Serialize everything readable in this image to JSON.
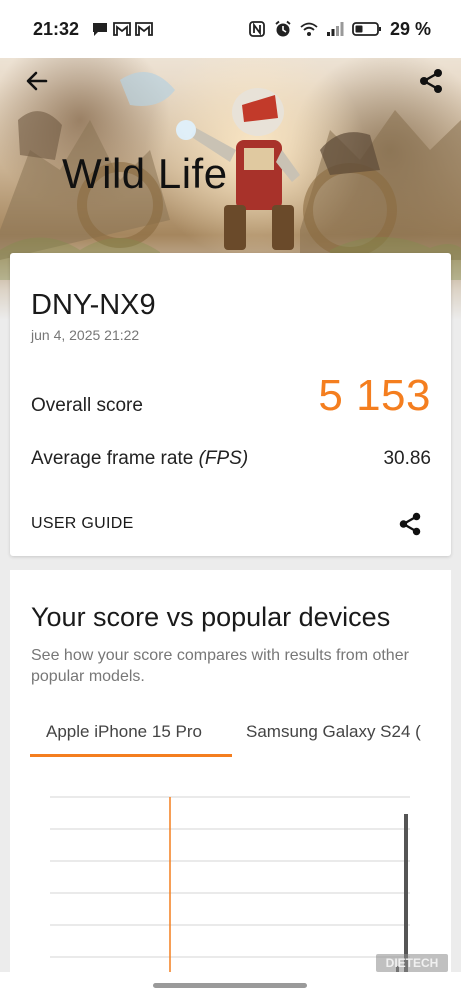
{
  "status_bar": {
    "time": "21:32",
    "battery_percent": "29 %",
    "left_icons": [
      "chat-bubble-icon",
      "gmail-icon",
      "gmail-icon"
    ],
    "right_icons": [
      "nfc-icon",
      "alarm-icon",
      "wifi-icon",
      "signal-icon",
      "battery-icon"
    ]
  },
  "header": {
    "title": "Wild Life",
    "back_icon": "arrow-left-icon",
    "share_icon": "share-icon"
  },
  "result_card": {
    "device_name": "DNY-NX9",
    "date": "jun 4, 2025 21:22",
    "overall_label": "Overall score",
    "overall_value": "5 153",
    "fps_label": "Average frame rate",
    "fps_unit": "(FPS)",
    "fps_value": "30.86",
    "guide_label": "USER GUIDE"
  },
  "comparison": {
    "title": "Your score vs popular devices",
    "description": "See how your score compares with results from other popular models.",
    "tabs": [
      {
        "label": "Apple iPhone 15 Pro",
        "selected": true
      },
      {
        "label": "Samsung Galaxy S24 (",
        "selected": false
      }
    ]
  },
  "watermark": "DIETECH",
  "colors": {
    "accent": "#f47e1f",
    "card": "#ffffff",
    "background": "#ececec"
  }
}
